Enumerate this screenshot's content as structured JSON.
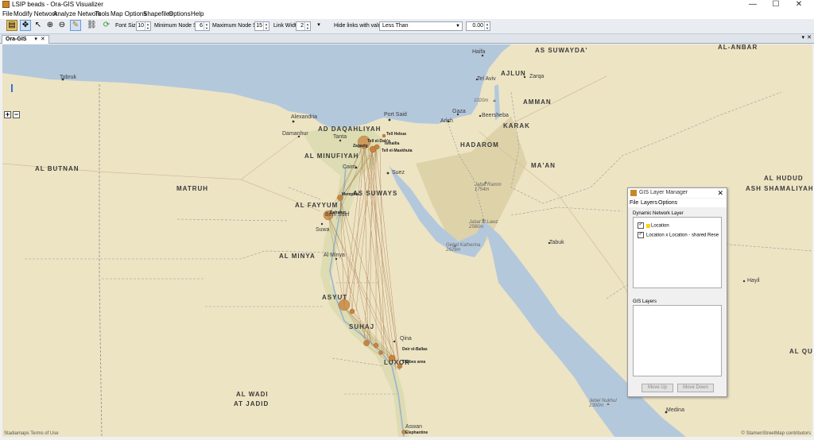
{
  "window": {
    "title": "LSIP beads - Ora-GIS Visualizer",
    "minimize": "—",
    "maximize": "☐",
    "close": "✕"
  },
  "menu": [
    "File",
    "Modify Network",
    "Analyze Network",
    "Tools",
    "Map Options",
    "Shapefiles",
    "Options",
    "Help"
  ],
  "toolbar": {
    "font_size_label": "Font Size",
    "font_size": "10",
    "min_node_label": "Minimum Node Size",
    "min_node": "6",
    "max_node_label": "Maximum Node Size",
    "max_node": "15",
    "link_width_label": "Link Width",
    "link_width": "2",
    "hide_links_label": "Hide links with value:",
    "hide_links_op": "Less Than",
    "hide_links_value": "0.00"
  },
  "tab": {
    "label": "Ora-GIS",
    "pin": "▾",
    "close": "✕"
  },
  "map": {
    "regions": [
      "AS SUWAYDA'",
      "AL-ANBAR",
      "AJLUN",
      "AMMAN",
      "KARAK",
      "HADAROM",
      "MA'AN",
      "AL HUDUD",
      "ASH SHAMALIYAH",
      "AD DAQAHLIYAH",
      "AL MINUFIYAH",
      "AL BUTNAN",
      "MATRUH",
      "AS SUWAYS",
      "AL FAYYUM",
      "AL MINYA",
      "ASYUT",
      "SUHAJ",
      "LUXOR",
      "AL WADI",
      "AT JADID",
      "AL QU"
    ],
    "cities": [
      "Tobruk",
      "Alexandria",
      "Damanhur",
      "Tanta",
      "Port Said",
      "Cairo",
      "Suez",
      "Beni Suef",
      "Suwa",
      "Al Minya",
      "Haifa",
      "Tel Aviv",
      "Zarqa",
      "Gaza",
      "Arish",
      "Beersheba",
      "Tabuk",
      "Hayil",
      "Medina",
      "Aswan",
      "Qina"
    ],
    "elevations": [
      "1020m",
      "Jabal Ramm 1754m",
      "Jabal al Lawz 2580m",
      "Gebel Katherina 2629m",
      "Jebel Nukhul 2300m"
    ],
    "network_nodes": [
      "Tell el-Dab'a",
      "Zagazig",
      "Ismailia",
      "Tell Hebua",
      "Tell el-Maskhuta",
      "Memphis",
      "Dahshur",
      "Deir el-Ballas",
      "Thebes area",
      "Elephantine"
    ],
    "credits": {
      "left": "Stadiamaps   Terms of Use",
      "right": "© StamenStreetMap contributors"
    },
    "zoom_in": "+",
    "zoom_out": "−"
  },
  "gis_manager": {
    "title": "GIS Layer Manager",
    "menu": [
      "File",
      "Layers",
      "Options"
    ],
    "dynamic_group": "Dynamic Network Layer",
    "layers": [
      {
        "label": "Location",
        "checked": "✓"
      },
      {
        "label": "Location x Location - shared Rese",
        "checked": "✓"
      }
    ],
    "gis_group": "GIS Layers",
    "move_up": "Move Up",
    "move_down": "Move Down",
    "close": "✕"
  }
}
